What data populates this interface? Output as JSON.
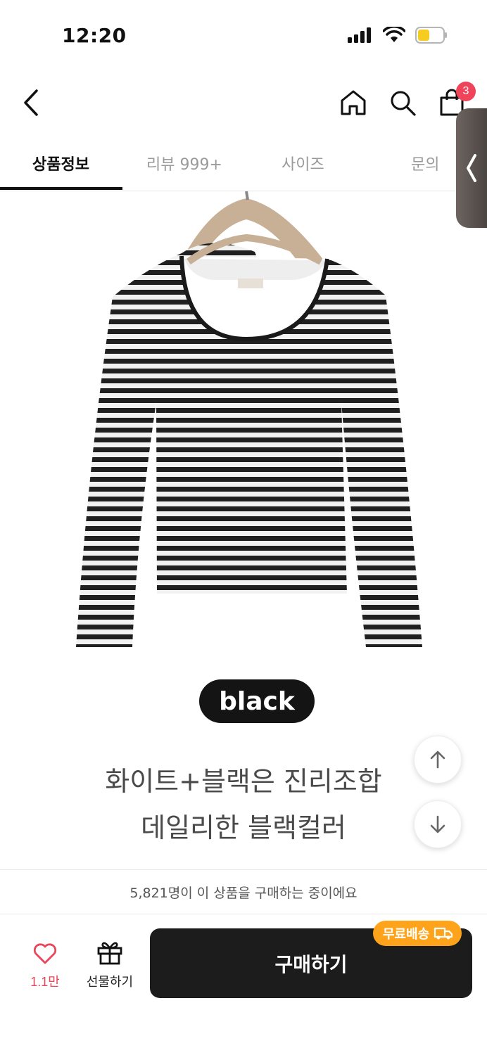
{
  "status_bar": {
    "time": "12:20"
  },
  "header": {
    "cart_count": "3"
  },
  "tabs": [
    {
      "label": "상품정보",
      "active": true
    },
    {
      "label": "리뷰 999+",
      "active": false
    },
    {
      "label": "사이즈",
      "active": false
    },
    {
      "label": "문의",
      "active": false
    }
  ],
  "product": {
    "color_label": "black",
    "description_line1": "화이트+블랙은 진리조합",
    "description_line2": "데일리한 블랙컬러"
  },
  "notice": {
    "text": "5,821명이 이 상품을 구매하는 중이에요"
  },
  "bottom_bar": {
    "like_count": "1.1만",
    "gift_label": "선물하기",
    "buy_label": "구매하기",
    "shipping_badge": "무료배송"
  },
  "colors": {
    "accent_red": "#f0445a",
    "badge_orange": "#ffa31a",
    "buy_button": "#1c1c1c"
  }
}
